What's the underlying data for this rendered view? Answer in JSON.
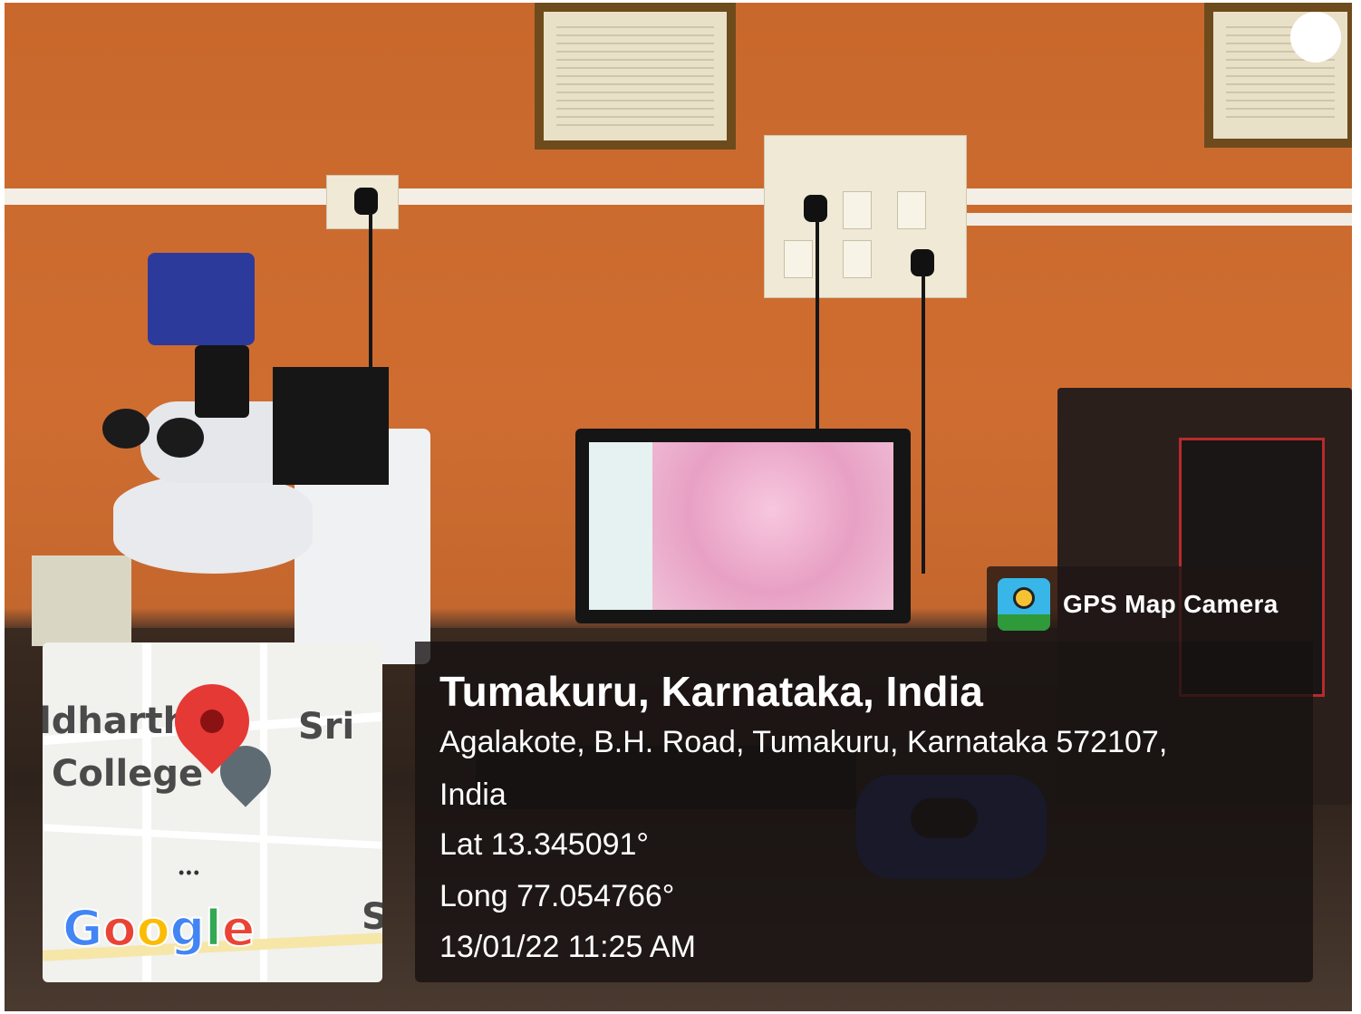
{
  "badge": {
    "label": "GPS Map Camera",
    "icon": "map-camera-icon"
  },
  "location": {
    "title": "Tumakuru, Karnataka, India",
    "address_line1": "Agalakote, B.H. Road, Tumakuru, Karnataka 572107,",
    "address_line2": "India",
    "latitude": "Lat 13.345091°",
    "longitude": "Long 77.054766°",
    "datetime": "13/01/22 11:25 AM"
  },
  "map": {
    "label_1": "ldharth",
    "label_2": "College",
    "label_3": "Sri",
    "label_4": "S",
    "dots": "•••",
    "provider": [
      "G",
      "o",
      "o",
      "g",
      "l",
      "e"
    ],
    "provider_colors": [
      "#4285F4",
      "#EA4335",
      "#FBBC05",
      "#4285F4",
      "#34A853",
      "#EA4335"
    ]
  },
  "colors": {
    "overlay": "#161212",
    "pin": "#e53935"
  }
}
